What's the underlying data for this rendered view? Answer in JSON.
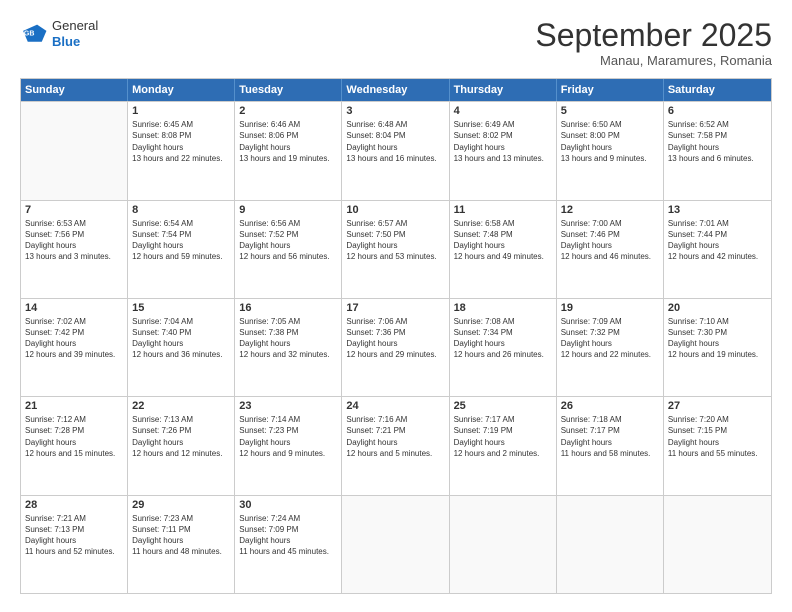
{
  "logo": {
    "general": "General",
    "blue": "Blue"
  },
  "title": "September 2025",
  "subtitle": "Manau, Maramures, Romania",
  "days": [
    "Sunday",
    "Monday",
    "Tuesday",
    "Wednesday",
    "Thursday",
    "Friday",
    "Saturday"
  ],
  "weeks": [
    [
      {
        "num": "",
        "empty": true
      },
      {
        "num": "1",
        "sunrise": "6:45 AM",
        "sunset": "8:08 PM",
        "daylight": "13 hours and 22 minutes."
      },
      {
        "num": "2",
        "sunrise": "6:46 AM",
        "sunset": "8:06 PM",
        "daylight": "13 hours and 19 minutes."
      },
      {
        "num": "3",
        "sunrise": "6:48 AM",
        "sunset": "8:04 PM",
        "daylight": "13 hours and 16 minutes."
      },
      {
        "num": "4",
        "sunrise": "6:49 AM",
        "sunset": "8:02 PM",
        "daylight": "13 hours and 13 minutes."
      },
      {
        "num": "5",
        "sunrise": "6:50 AM",
        "sunset": "8:00 PM",
        "daylight": "13 hours and 9 minutes."
      },
      {
        "num": "6",
        "sunrise": "6:52 AM",
        "sunset": "7:58 PM",
        "daylight": "13 hours and 6 minutes."
      }
    ],
    [
      {
        "num": "7",
        "sunrise": "6:53 AM",
        "sunset": "7:56 PM",
        "daylight": "13 hours and 3 minutes."
      },
      {
        "num": "8",
        "sunrise": "6:54 AM",
        "sunset": "7:54 PM",
        "daylight": "12 hours and 59 minutes."
      },
      {
        "num": "9",
        "sunrise": "6:56 AM",
        "sunset": "7:52 PM",
        "daylight": "12 hours and 56 minutes."
      },
      {
        "num": "10",
        "sunrise": "6:57 AM",
        "sunset": "7:50 PM",
        "daylight": "12 hours and 53 minutes."
      },
      {
        "num": "11",
        "sunrise": "6:58 AM",
        "sunset": "7:48 PM",
        "daylight": "12 hours and 49 minutes."
      },
      {
        "num": "12",
        "sunrise": "7:00 AM",
        "sunset": "7:46 PM",
        "daylight": "12 hours and 46 minutes."
      },
      {
        "num": "13",
        "sunrise": "7:01 AM",
        "sunset": "7:44 PM",
        "daylight": "12 hours and 42 minutes."
      }
    ],
    [
      {
        "num": "14",
        "sunrise": "7:02 AM",
        "sunset": "7:42 PM",
        "daylight": "12 hours and 39 minutes."
      },
      {
        "num": "15",
        "sunrise": "7:04 AM",
        "sunset": "7:40 PM",
        "daylight": "12 hours and 36 minutes."
      },
      {
        "num": "16",
        "sunrise": "7:05 AM",
        "sunset": "7:38 PM",
        "daylight": "12 hours and 32 minutes."
      },
      {
        "num": "17",
        "sunrise": "7:06 AM",
        "sunset": "7:36 PM",
        "daylight": "12 hours and 29 minutes."
      },
      {
        "num": "18",
        "sunrise": "7:08 AM",
        "sunset": "7:34 PM",
        "daylight": "12 hours and 26 minutes."
      },
      {
        "num": "19",
        "sunrise": "7:09 AM",
        "sunset": "7:32 PM",
        "daylight": "12 hours and 22 minutes."
      },
      {
        "num": "20",
        "sunrise": "7:10 AM",
        "sunset": "7:30 PM",
        "daylight": "12 hours and 19 minutes."
      }
    ],
    [
      {
        "num": "21",
        "sunrise": "7:12 AM",
        "sunset": "7:28 PM",
        "daylight": "12 hours and 15 minutes."
      },
      {
        "num": "22",
        "sunrise": "7:13 AM",
        "sunset": "7:26 PM",
        "daylight": "12 hours and 12 minutes."
      },
      {
        "num": "23",
        "sunrise": "7:14 AM",
        "sunset": "7:23 PM",
        "daylight": "12 hours and 9 minutes."
      },
      {
        "num": "24",
        "sunrise": "7:16 AM",
        "sunset": "7:21 PM",
        "daylight": "12 hours and 5 minutes."
      },
      {
        "num": "25",
        "sunrise": "7:17 AM",
        "sunset": "7:19 PM",
        "daylight": "12 hours and 2 minutes."
      },
      {
        "num": "26",
        "sunrise": "7:18 AM",
        "sunset": "7:17 PM",
        "daylight": "11 hours and 58 minutes."
      },
      {
        "num": "27",
        "sunrise": "7:20 AM",
        "sunset": "7:15 PM",
        "daylight": "11 hours and 55 minutes."
      }
    ],
    [
      {
        "num": "28",
        "sunrise": "7:21 AM",
        "sunset": "7:13 PM",
        "daylight": "11 hours and 52 minutes."
      },
      {
        "num": "29",
        "sunrise": "7:23 AM",
        "sunset": "7:11 PM",
        "daylight": "11 hours and 48 minutes."
      },
      {
        "num": "30",
        "sunrise": "7:24 AM",
        "sunset": "7:09 PM",
        "daylight": "11 hours and 45 minutes."
      },
      {
        "num": "",
        "empty": true
      },
      {
        "num": "",
        "empty": true
      },
      {
        "num": "",
        "empty": true
      },
      {
        "num": "",
        "empty": true
      }
    ]
  ]
}
